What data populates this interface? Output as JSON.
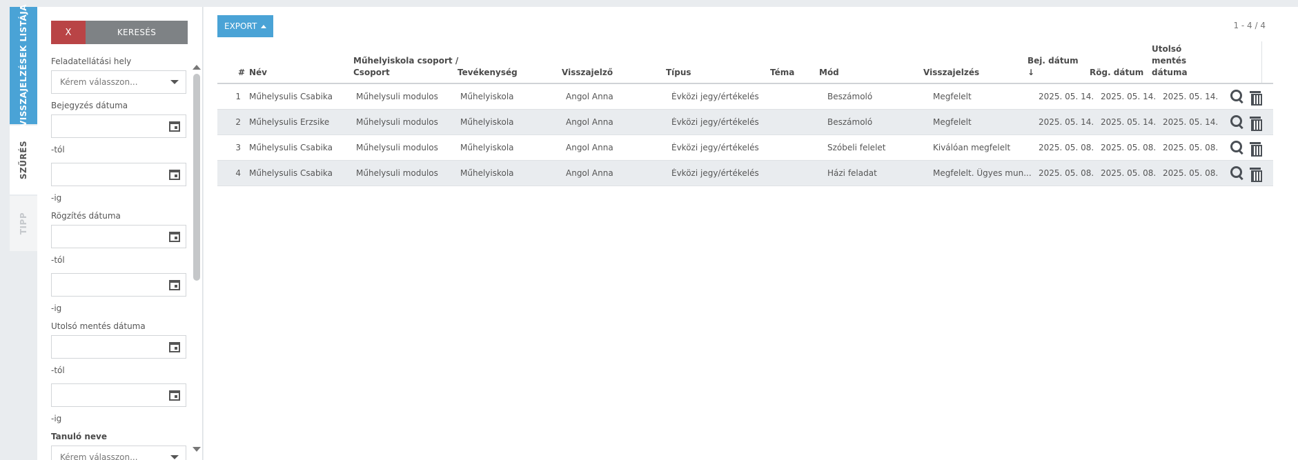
{
  "side_tabs": {
    "list": "VISSZAJELZÉSEK LISTÁJA",
    "filter": "SZŰRÉS",
    "tip": "TIPP"
  },
  "filter": {
    "clear_label": "X",
    "search_label": "KERESÉS",
    "location_label": "Feladatellátási hely",
    "select_placeholder": "Kérem válasszon...",
    "entry_date_label": "Bejegyzés dátuma",
    "record_date_label": "Rögzítés dátuma",
    "last_save_label": "Utolsó mentés dátuma",
    "student_label": "Tanuló neve",
    "from_suffix": "-tól",
    "to_suffix": "-ig"
  },
  "toolbar": {
    "export_label": "EXPORT",
    "pager": "1 - 4 / 4"
  },
  "table": {
    "headers": {
      "num": "#",
      "name": "Név",
      "group_line1": "Műhelyiskola csoport /",
      "group_line2": "Csoport",
      "activity": "Tevékenység",
      "reporter": "Visszajelző",
      "type": "Típus",
      "topic": "Téma",
      "mode": "Mód",
      "feedback": "Visszajelzés",
      "entry_date_line1": "Bej. dátum",
      "entry_date_sort": "↓",
      "record_date": "Rög. dátum",
      "last_save_line1": "Utolsó",
      "last_save_line2": "mentés",
      "last_save_line3": "dátuma"
    },
    "rows": [
      {
        "num": "1",
        "name": "Műhelysulis Csabika",
        "group": "Műhelysuli modulos",
        "activity": "Műhelyiskola",
        "reporter": "Angol Anna",
        "type": "Évközi jegy/értékelés",
        "topic": "",
        "mode": "Beszámoló",
        "feedback": "Megfelelt",
        "entry_date": "2025. 05. 14.",
        "record_date": "2025. 05. 14.",
        "last_save": "2025. 05. 14."
      },
      {
        "num": "2",
        "name": "Műhelysulis Erzsike",
        "group": "Műhelysuli modulos",
        "activity": "Műhelyiskola",
        "reporter": "Angol Anna",
        "type": "Évközi jegy/értékelés",
        "topic": "",
        "mode": "Beszámoló",
        "feedback": "Megfelelt",
        "entry_date": "2025. 05. 14.",
        "record_date": "2025. 05. 14.",
        "last_save": "2025. 05. 14."
      },
      {
        "num": "3",
        "name": "Műhelysulis Csabika",
        "group": "Műhelysuli modulos",
        "activity": "Műhelyiskola",
        "reporter": "Angol Anna",
        "type": "Évközi jegy/értékelés",
        "topic": "",
        "mode": "Szóbeli felelet",
        "feedback": "Kiválóan megfelelt",
        "entry_date": "2025. 05. 08.",
        "record_date": "2025. 05. 08.",
        "last_save": "2025. 05. 08."
      },
      {
        "num": "4",
        "name": "Műhelysulis Csabika",
        "group": "Műhelysuli modulos",
        "activity": "Műhelyiskola",
        "reporter": "Angol Anna",
        "type": "Évközi jegy/értékelés",
        "topic": "",
        "mode": "Házi feladat",
        "feedback": "Megfelelt. Ügyes mun...",
        "entry_date": "2025. 05. 08.",
        "record_date": "2025. 05. 08.",
        "last_save": "2025. 05. 08."
      }
    ]
  },
  "colors": {
    "accent": "#4aa3d6",
    "danger": "#b94446",
    "secondary": "#7e8285",
    "row_alt": "#e9ecef"
  }
}
